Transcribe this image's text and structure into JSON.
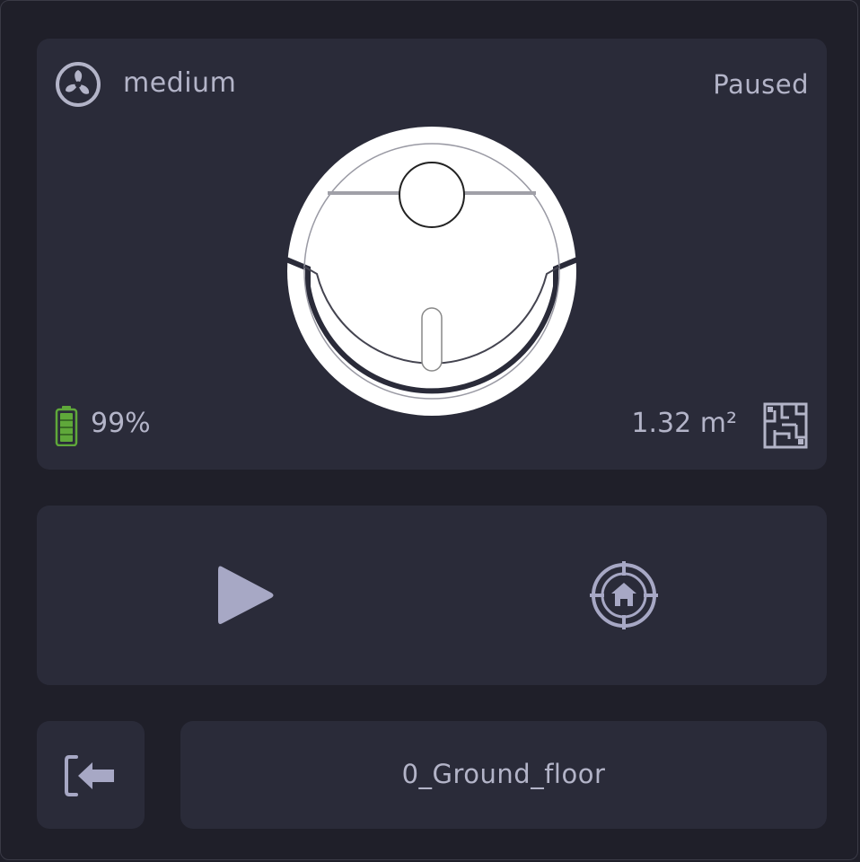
{
  "status": {
    "fan_speed": "medium",
    "state": "Paused",
    "battery": "99%",
    "area": "1.32 m²"
  },
  "controls": {
    "primary_action": "play",
    "secondary_action": "return-home"
  },
  "footer": {
    "floor": "0_Ground_floor"
  },
  "colors": {
    "card": "#2a2b39",
    "background": "#1f1f29",
    "text": "#b3b4c8",
    "battery": "#5fa83a"
  },
  "icons": {
    "fan": "fan-icon",
    "battery": "battery-icon",
    "map": "floor-map-icon",
    "play": "play-icon",
    "home": "dock-home-icon",
    "exit": "sign-in-arrow-icon"
  }
}
